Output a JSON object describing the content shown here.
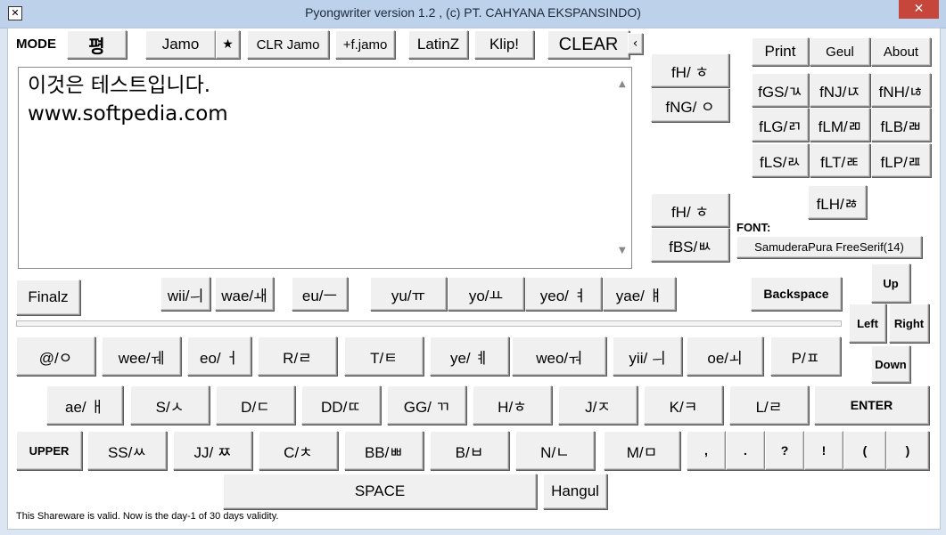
{
  "window": {
    "title": "Pyongwriter version 1.2 ,  (c) PT. CAHYANA EKSPANSINDO)",
    "close_symbol": "✕",
    "icon_glyph": "✕"
  },
  "mode": {
    "label": "MODE",
    "char": "평"
  },
  "toolbar": {
    "jamo": "Jamo",
    "star": "★",
    "clr_jamo": "CLR Jamo",
    "fjamo": "+f.jamo",
    "latinz": "LatinZ",
    "klip": "Klip!",
    "clear": "CLEAR",
    "collapse": "‹"
  },
  "editor": {
    "line1": "이것은 테스트입니다.",
    "line2": "www.softpedia.com"
  },
  "right_panel": {
    "print": "Print",
    "geul": "Geul",
    "about": "About",
    "fH1": "fH/ ㅎ",
    "fNG": "fNG/ ㅇ",
    "fGS": "fGS/ㄳ",
    "fNJ": "fNJ/ㄵ",
    "fNH": "fNH/ㄶ",
    "fLG": "fLG/ㄺ",
    "fLM": "fLM/ㄻ",
    "fLB": "fLB/ㄼ",
    "fLS": "fLS/ㄽ",
    "fLT": "fLT/ㄾ",
    "fLP": "fLP/ㄿ",
    "fLH": "fLH/ㅀ",
    "fH2": "fH/ ㅎ",
    "fBS": "fBS/ㅄ",
    "font_label": "FONT:",
    "font_value": "SamuderaPura FreeSerif(14)"
  },
  "nav": {
    "up": "Up",
    "left": "Left",
    "right": "Right",
    "down": "Down",
    "backspace": "Backspace"
  },
  "vowel_row": {
    "finalz": "Finalz",
    "keys": [
      "wii/ㅢ",
      "wae/ㅙ",
      "eu/ㅡ",
      "yu/ㅠ",
      "yo/ㅛ",
      "yeo/ ㅕ",
      "yae/ ㅒ"
    ]
  },
  "row1": [
    "@/ㅇ",
    "wee/ㅞ",
    "eo/     ㅓ",
    "R/ㄹ",
    "T/ㅌ",
    "ye/ ㅖ",
    "weo/ㅝ",
    "yii/ ㅢ",
    "oe/ㅚ",
    "P/ㅍ"
  ],
  "row2": [
    "ae/ ㅐ",
    "S/ㅅ",
    "D/ㄷ",
    "DD/ㄸ",
    "GG/  ㄲ",
    "H/ㅎ",
    "J/ㅈ",
    "K/ㅋ",
    "L/ㄹ",
    "ENTER"
  ],
  "row3": [
    "UPPER",
    "SS/ㅆ",
    "JJ/    ㅉ",
    "C/ㅊ",
    "BB/ㅃ",
    "B/ㅂ",
    "N/ㄴ",
    "M/ㅁ",
    ",",
    ".",
    "?",
    "!",
    "(",
    ")"
  ],
  "bottom": {
    "space": "SPACE",
    "hangul": "Hangul"
  },
  "status": "This Shareware is valid. Now is the day-1 of 30 days validity."
}
